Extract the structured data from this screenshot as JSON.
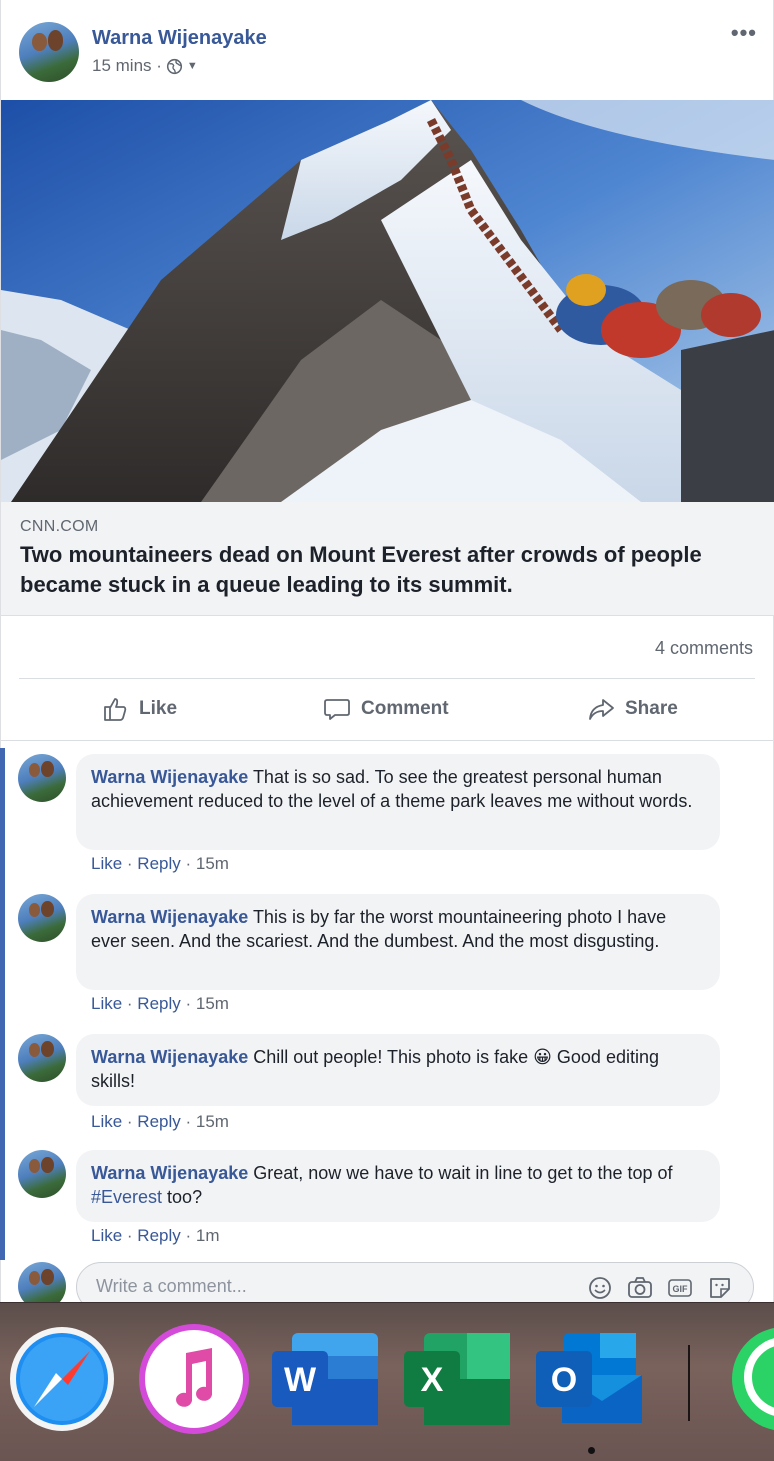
{
  "post": {
    "author": "Warna Wijenayake",
    "time": "15 mins · ",
    "more_label": "•••",
    "link": {
      "domain": "CNN.COM",
      "headline": "Two mountaineers dead on Mount Everest after crowds of people became stuck in a queue leading to its summit."
    },
    "comment_count": "4 comments",
    "actions": {
      "like": "Like",
      "comment": "Comment",
      "share": "Share"
    }
  },
  "comments": [
    {
      "author": "Warna Wijenayake",
      "text": "That is so sad. To see the greatest personal human achievement reduced to the level of a theme park leaves me without words.",
      "like": "Like",
      "reply": "Reply",
      "time": "15m"
    },
    {
      "author": "Warna Wijenayake",
      "text": "This is by far the worst mountaineering photo I have ever seen. And the scariest. And the dumbest. And the most disgusting.",
      "like": "Like",
      "reply": "Reply",
      "time": "15m"
    },
    {
      "author": "Warna Wijenayake",
      "text": "Chill out people! This photo is fake",
      "emoji": "😀",
      "text2": "Good editing skills!",
      "like": "Like",
      "reply": "Reply",
      "time": "15m"
    },
    {
      "author": "Warna Wijenayake",
      "text_before": "Great, now we have to wait in line to get to the top of ",
      "hashtag": "#Everest",
      "text_after": " too?",
      "like": "Like",
      "reply": "Reply",
      "time": "1m"
    }
  ],
  "composer": {
    "placeholder": "Write a comment...",
    "gif_label": "GIF"
  },
  "dock": {
    "apps": [
      "Safari",
      "iTunes",
      "Word",
      "Excel",
      "Outlook",
      "WhatsApp"
    ],
    "word_letter": "W",
    "excel_letter": "X",
    "outlook_letter": "O"
  },
  "colors": {
    "link": "#385898",
    "accent": "#4267b2",
    "muted": "#606770",
    "bubble": "#f2f3f5"
  }
}
